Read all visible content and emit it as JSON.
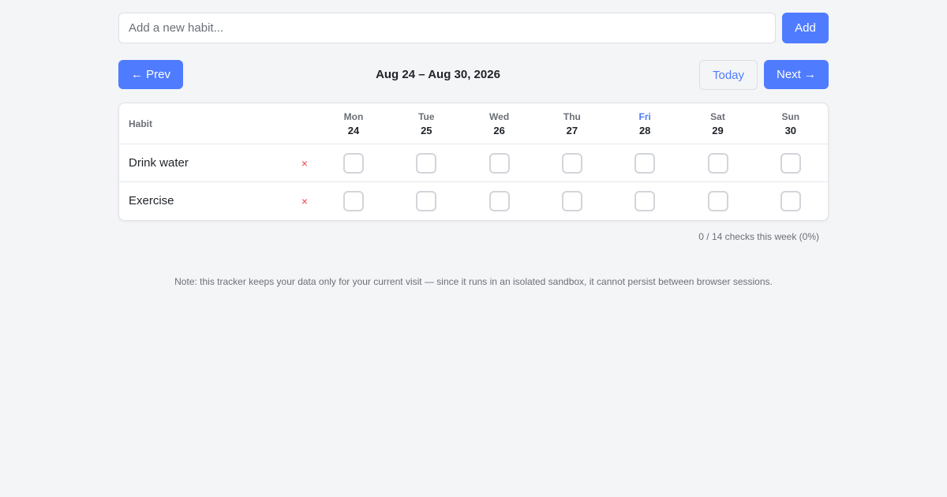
{
  "add": {
    "placeholder": "Add a new habit...",
    "button_label": "Add"
  },
  "nav": {
    "prev_label": "← Prev",
    "week_range": "Aug 24 – Aug 30, 2026",
    "today_label": "Today",
    "next_label": "Next →"
  },
  "table": {
    "habit_header": "Habit",
    "days": [
      {
        "name": "Mon",
        "num": "24",
        "is_today": false
      },
      {
        "name": "Tue",
        "num": "25",
        "is_today": false
      },
      {
        "name": "Wed",
        "num": "26",
        "is_today": false
      },
      {
        "name": "Thu",
        "num": "27",
        "is_today": false
      },
      {
        "name": "Fri",
        "num": "28",
        "is_today": true
      },
      {
        "name": "Sat",
        "num": "29",
        "is_today": false
      },
      {
        "name": "Sun",
        "num": "30",
        "is_today": false
      }
    ],
    "habits": [
      {
        "name": "Drink water",
        "checks": [
          false,
          false,
          false,
          false,
          false,
          false,
          false
        ]
      },
      {
        "name": "Exercise",
        "checks": [
          false,
          false,
          false,
          false,
          false,
          false,
          false
        ]
      }
    ],
    "delete_icon": "close-icon"
  },
  "summary": "0 / 14 checks this week (0%)",
  "note": "Note: this tracker keeps your data only for your current visit — since it runs in an isolated sandbox, it cannot persist between browser sessions.",
  "colors": {
    "accent": "#4f7cff",
    "delete": "#e5484d",
    "background": "#f4f5f7"
  }
}
